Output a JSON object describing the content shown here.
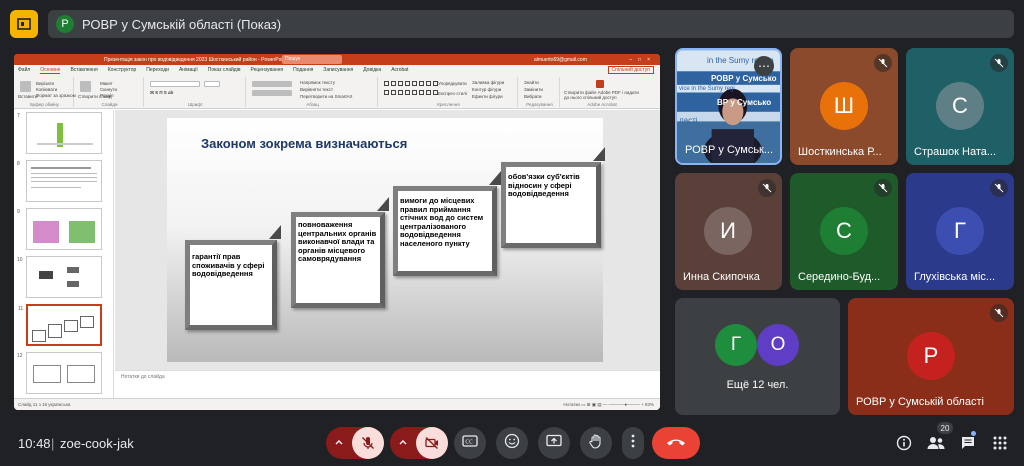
{
  "meet": {
    "title": "РОВР у Сумській області (Показ)",
    "presenter_initial": "Р",
    "time": "10:48",
    "meeting_code": "zoe-cook-jak",
    "people_count": "20"
  },
  "powerpoint": {
    "doc_title": "Презентація закон про водовідведення 2023 Шосткинський район - PowerPoint",
    "search_placeholder": "Пошук",
    "user": "almuerto69@gmail.com",
    "window_controls": "–□×",
    "tabs": [
      "Файл",
      "Основне",
      "Вставлення",
      "Конструктор",
      "Переходи",
      "Анімації",
      "Показ слайдів",
      "Рецензування",
      "Подання",
      "Записування",
      "Довідка",
      "Acrobat"
    ],
    "active_tab_index": 1,
    "share_label": "Спільний доступ",
    "ribbon_groups": [
      "Буфер обміну",
      "Слайди",
      "Шрифт",
      "Абзац",
      "Креслення",
      "Редагування",
      "Adobe Acrobat"
    ],
    "ribbon_items": {
      "paste": "Вставити",
      "cut": "Вирізати",
      "copy": "Копіювати",
      "format": "Формат за зразком",
      "new_slide": "Створити слайд",
      "layout": "Макет",
      "reset": "Скинути",
      "section": "Розділ",
      "arrange": "Упорядкувати",
      "quick_styles": "Експрес-стилі",
      "fill": "Заливка фігури",
      "outline": "Контур фігури",
      "effects": "Ефекти фігури",
      "find": "Знайти",
      "replace": "Замінити",
      "select": "Вибрати",
      "acrobat": "Створити файл Adobe PDF і надати до нього спільний доступ",
      "text_dir": "Напрямок тексту",
      "align_text": "Вирівняти текст",
      "smartart": "Перетворити на SmartArt"
    },
    "thumb_numbers": [
      "7",
      "8",
      "9",
      "10",
      "11",
      "12"
    ],
    "selected_thumb_index": 4,
    "notes_placeholder": "Нотатки до слайда",
    "status_left": "Слайд 11 з 18    українська",
    "status_right": "Нотатки   ▭   ⊞   ▣   ▤   — ─────●──── +  83%"
  },
  "slide": {
    "title": "Законом зокрема визначаються",
    "steps": [
      "гарантії прав споживачів у сфері водовідведення",
      "повноваження центральних органів виконавчої влади та органів місцевого самоврядування",
      "вимоги до місцевих правил приймання стічних вод до систем централізованого водовідведення населеного пункту",
      "обов'язки суб'єктів відносин у сфері водовідведення"
    ]
  },
  "tiles": [
    {
      "name": "РОВР у Сумськ...",
      "type": "camera",
      "banner_text": "in the Sumy region",
      "banner_text2": "РОВР у Сумсько",
      "banner_text3": "vice in the Sumy regi",
      "banner_text4": "ВР у Сумсько",
      "banner_text5": "ласті"
    },
    {
      "name": "Шосткинська Р...",
      "initial": "Ш",
      "bg": "#8a4a2b",
      "avatar": "#e8710a"
    },
    {
      "name": "Страшок Ната...",
      "initial": "С",
      "bg": "#1f5f66",
      "avatar": "#5f7f87"
    },
    {
      "name": "Инна Скипочка",
      "initial": "И",
      "bg": "#5a4038",
      "avatar": "#7b6560"
    },
    {
      "name": "Середино-Буд...",
      "initial": "С",
      "bg": "#1e5a2a",
      "avatar": "#1e7e34"
    },
    {
      "name": "Глухівська міс...",
      "initial": "Г",
      "bg": "#2b3a8a",
      "avatar": "#3c4fb0"
    },
    {
      "name": "Ещё 12 чел.",
      "initial_a": "Г",
      "initial_b": "О",
      "bg": "#3c4043",
      "avatar_a": "#1e8e3e",
      "avatar_b": "#5f3dc4"
    },
    {
      "name": "РОВР у Сумській області",
      "initial": "Р",
      "bg": "#8a2e1a",
      "avatar": "#c5221f"
    }
  ],
  "colors": {
    "ppt_accent": "#c43e1c",
    "hangup": "#ea4335",
    "muted_state": "#f9dedc",
    "meet_bg": "#202124"
  },
  "icons": {
    "mic": "mic-off-icon",
    "cam": "camera-off-icon",
    "captions": "captions-icon",
    "emoji": "emoji-icon",
    "present": "present-icon",
    "hand": "raise-hand-icon",
    "more": "more-vert-icon",
    "hangup": "call-end-icon",
    "info": "info-icon",
    "people": "people-icon",
    "chat": "chat-icon",
    "activities": "apps-icon"
  }
}
